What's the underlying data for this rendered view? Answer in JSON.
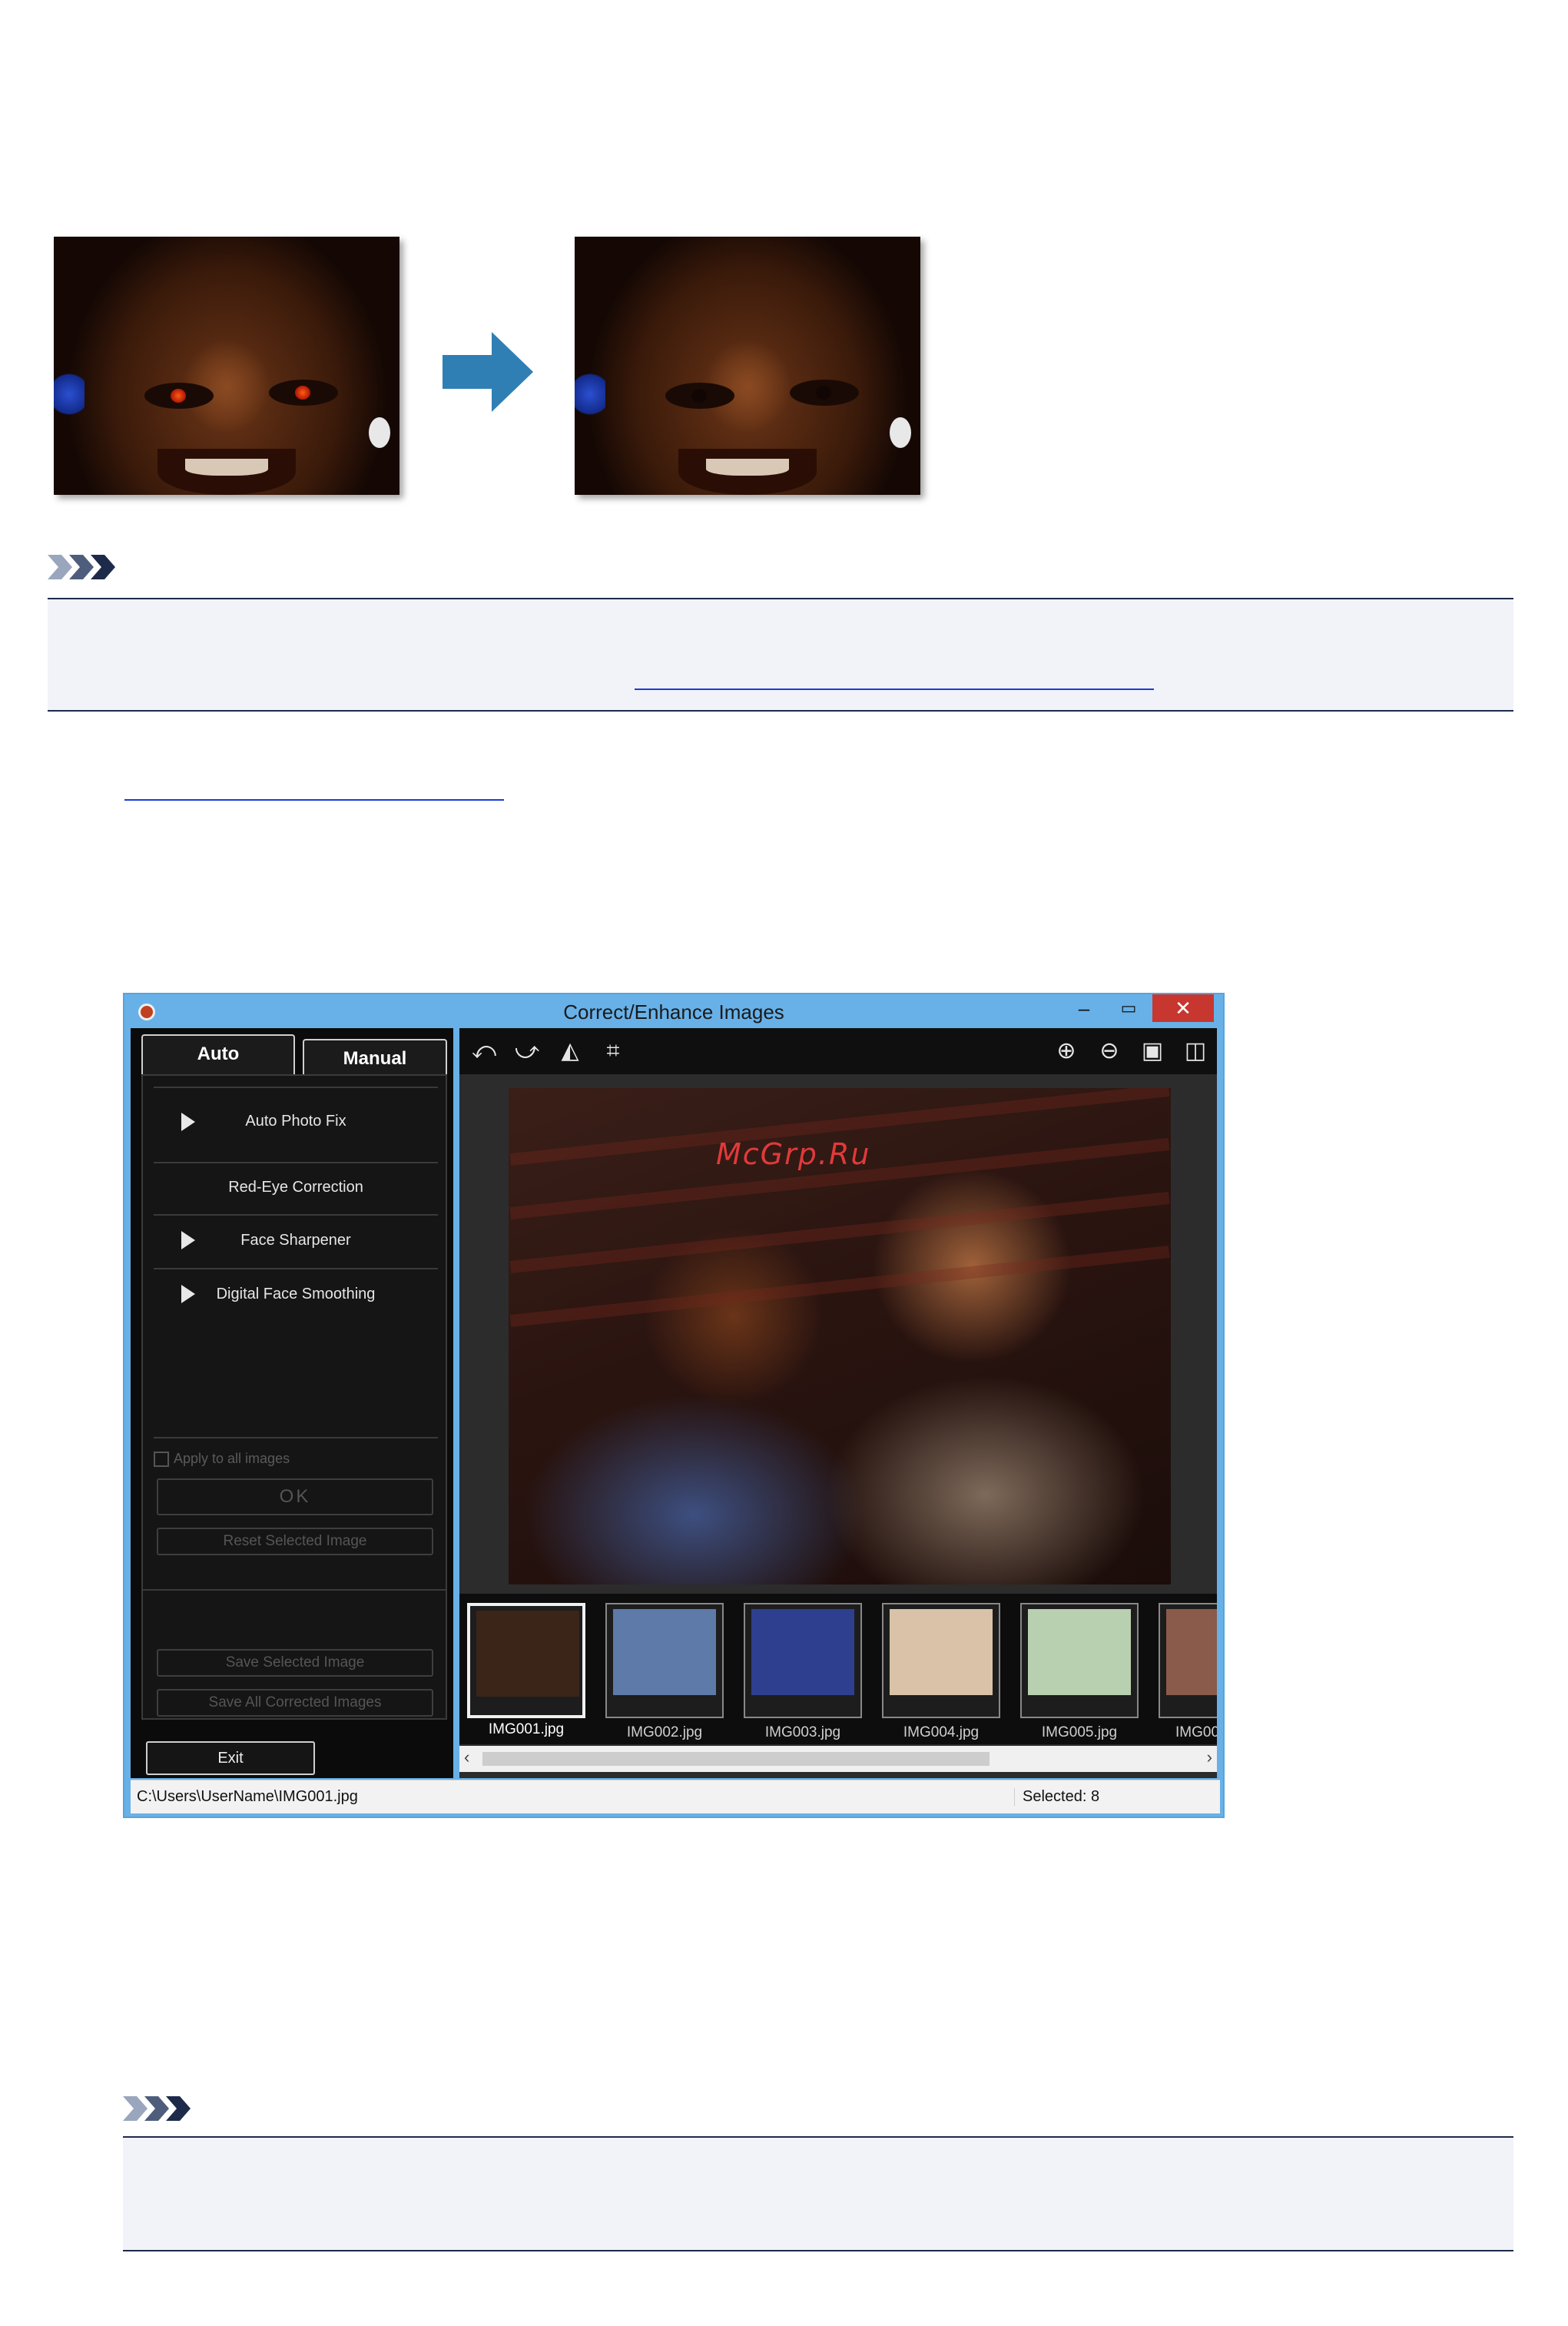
{
  "window": {
    "title": "Correct/Enhance Images",
    "minimize": "–",
    "maximize": "▭",
    "close": "✕"
  },
  "tabs": {
    "auto": "Auto",
    "manual": "Manual"
  },
  "auto_menu": [
    {
      "label": "Auto Photo Fix",
      "has_arrow": true
    },
    {
      "label": "Red-Eye Correction",
      "has_arrow": false
    },
    {
      "label": "Face Sharpener",
      "has_arrow": true
    },
    {
      "label": "Digital Face Smoothing",
      "has_arrow": true
    }
  ],
  "controls": {
    "apply_all": "Apply to all images",
    "ok": "OK",
    "reset": "Reset Selected Image",
    "save_selected": "Save Selected Image",
    "save_all": "Save All Corrected Images",
    "exit": "Exit"
  },
  "watermark": "McGrp.Ru",
  "thumbnails": [
    {
      "label": "IMG001.jpg",
      "selected": true,
      "color": "#3b2418"
    },
    {
      "label": "IMG002.jpg",
      "selected": false,
      "color": "#5d7aa8"
    },
    {
      "label": "IMG003.jpg",
      "selected": false,
      "color": "#2e3f8f"
    },
    {
      "label": "IMG004.jpg",
      "selected": false,
      "color": "#d9c2a8"
    },
    {
      "label": "IMG005.jpg",
      "selected": false,
      "color": "#b8cfb0"
    },
    {
      "label": "IMG00",
      "selected": false,
      "color": "#8a5a4a"
    }
  ],
  "status": {
    "path": "C:\\Users\\UserName\\IMG001.jpg",
    "selected": "Selected: 8"
  },
  "colors": {
    "window_frame": "#67b1e8",
    "close_button": "#c7372f",
    "arrow": "#2f7fb5",
    "note_rule": "#1d2a4a",
    "link": "#1b3bd6"
  },
  "icons": {
    "toolbar_left": [
      "rotate-left-icon",
      "rotate-right-icon",
      "flip-icon",
      "crop-icon"
    ],
    "toolbar_right": [
      "zoom-in-icon",
      "zoom-out-icon",
      "full-screen-icon",
      "compare-icon"
    ]
  }
}
